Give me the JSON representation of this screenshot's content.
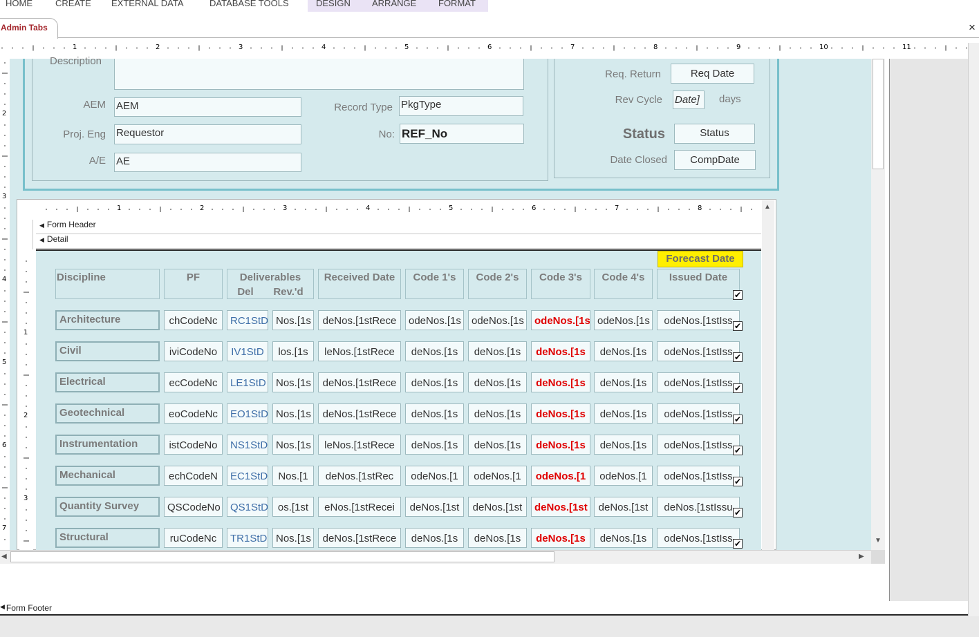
{
  "ribbon": {
    "tabs": [
      "HOME",
      "CREATE",
      "EXTERNAL DATA",
      "DATABASE TOOLS",
      "DESIGN",
      "ARRANGE",
      "FORMAT"
    ]
  },
  "document": {
    "tab_title": "Admin Tabs",
    "close_glyph": "×"
  },
  "ruler": {
    "top_numbers": [
      "1",
      "2",
      "3",
      "4",
      "5",
      "6",
      "7",
      "8",
      "9",
      "10",
      "11"
    ],
    "left_numbers": [
      "2",
      "3",
      "4",
      "5",
      "6",
      "7"
    ],
    "sub_numbers": [
      "1",
      "2",
      "3",
      "4",
      "5",
      "6",
      "7",
      "8"
    ],
    "sub_left_numbers": [
      "1",
      "2",
      "3"
    ]
  },
  "header_form": {
    "description_label": "Description",
    "aem_label": "AEM",
    "aem_value": "AEM",
    "proj_eng_label": "Proj. Eng",
    "proj_eng_value": "Requestor",
    "ae_label": "A/E",
    "ae_value": "AE",
    "record_type_label": "Record Type",
    "record_type_value": "PkgType",
    "no_label": "No:",
    "no_value": "REF_No",
    "req_return_label": "Req. Return",
    "req_return_value": "Req Date",
    "rev_cycle_label": "Rev Cycle",
    "rev_cycle_value": "Date]",
    "rev_cycle_unit": "days",
    "status_label": "Status",
    "status_value": "Status",
    "date_closed_label": "Date Closed",
    "date_closed_value": "CompDate"
  },
  "subform": {
    "form_header": "Form Header",
    "detail": "Detail",
    "form_footer": "Form Footer",
    "forecast_label": "Forecast Date",
    "columns": {
      "discipline": "Discipline",
      "pf": "PF",
      "deliverables": "Deliverables",
      "del": "Del",
      "revd": "Rev.'d",
      "received": "Received Date",
      "code1": "Code 1's",
      "code2": "Code 2's",
      "code3": "Code 3's",
      "code4": "Code 4's",
      "issued": "Issued Date"
    },
    "rows": [
      {
        "discipline": "Architecture",
        "pf": "chCodeNc",
        "del": "RC1StD",
        "rev": "Nos.[1s",
        "received": "deNos.[1stRece",
        "c1": "odeNos.[1s",
        "c2": "odeNos.[1s",
        "c3": "odeNos.[1s",
        "c4": "odeNos.[1s",
        "issued": "odeNos.[1stIss"
      },
      {
        "discipline": "Civil",
        "pf": "iviCodeNo",
        "del": "IV1StD",
        "rev": "los.[1s",
        "received": "leNos.[1stRece",
        "c1": "deNos.[1s",
        "c2": "deNos.[1s",
        "c3": "deNos.[1s",
        "c4": "deNos.[1s",
        "issued": "odeNos.[1stIss"
      },
      {
        "discipline": "Electrical",
        "pf": "ecCodeNc",
        "del": "LE1StD",
        "rev": "Nos.[1s",
        "received": "deNos.[1stRece",
        "c1": "deNos.[1s",
        "c2": "deNos.[1s",
        "c3": "deNos.[1s",
        "c4": "deNos.[1s",
        "issued": "odeNos.[1stIss"
      },
      {
        "discipline": "Geotechnical",
        "pf": "eoCodeNc",
        "del": "EO1StD",
        "rev": "Nos.[1s",
        "received": "deNos.[1stRece",
        "c1": "deNos.[1s",
        "c2": "deNos.[1s",
        "c3": "deNos.[1s",
        "c4": "deNos.[1s",
        "issued": "odeNos.[1stIss"
      },
      {
        "discipline": "Instrumentation",
        "pf": "istCodeNo",
        "del": "NS1StD",
        "rev": "Nos.[1s",
        "received": "leNos.[1stRece",
        "c1": "deNos.[1s",
        "c2": "deNos.[1s",
        "c3": "deNos.[1s",
        "c4": "deNos.[1s",
        "issued": "odeNos.[1stIss"
      },
      {
        "discipline": "Mechanical",
        "pf": "echCodeN",
        "del": "EC1StD",
        "rev": "Nos.[1",
        "received": "deNos.[1stRec",
        "c1": "odeNos.[1",
        "c2": "odeNos.[1",
        "c3": "odeNos.[1",
        "c4": "odeNos.[1",
        "issued": "odeNos.[1stIss"
      },
      {
        "discipline": "Quantity Survey",
        "pf": "QSCodeNo",
        "del": "QS1StDe",
        "rev": "os.[1st",
        "received": "eNos.[1stRecei",
        "c1": "deNos.[1st",
        "c2": "deNos.[1st",
        "c3": "deNos.[1st",
        "c4": "deNos.[1st",
        "issued": "deNos.[1stIssu"
      },
      {
        "discipline": "Structural",
        "pf": "ruCodeNc",
        "del": "TR1StD",
        "rev": "Nos.[1s",
        "received": "deNos.[1stRece",
        "c1": "deNos.[1s",
        "c2": "deNos.[1s",
        "c3": "deNos.[1s",
        "c4": "deNos.[1s",
        "issued": "odeNos.[1stIss"
      }
    ]
  },
  "colors": {
    "canvas": "#d5eaed",
    "frame": "#78c0cb",
    "code3_text": "#e00000",
    "forecast_bg": "#ffef00",
    "tab_title": "#a4262c"
  }
}
